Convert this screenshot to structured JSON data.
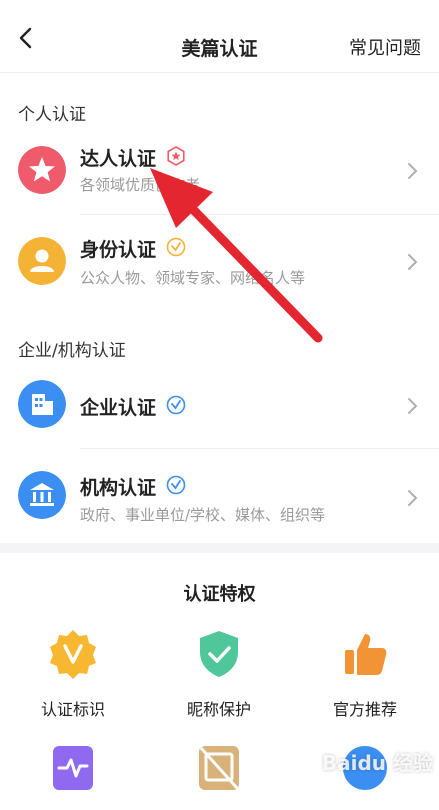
{
  "header": {
    "title": "美篇认证",
    "faq_label": "常见问题"
  },
  "personal": {
    "section_title": "个人认证",
    "items": [
      {
        "name": "达人认证",
        "desc": "各领域优质创作者",
        "icon": "star-icon",
        "color": "#ef5b6b",
        "badge": "red-star-badge-icon"
      },
      {
        "name": "身份认证",
        "desc": "公众人物、领域专家、网络名人等",
        "icon": "person-icon",
        "color": "#f5b335",
        "badge": "yellow-check-badge-icon"
      }
    ]
  },
  "org": {
    "section_title": "企业/机构认证",
    "items": [
      {
        "name": "企业认证",
        "desc": "",
        "icon": "building-icon",
        "color": "#3b8ef2",
        "badge": "blue-check-badge-icon"
      },
      {
        "name": "机构认证",
        "desc": "政府、事业单位/学校、媒体、组织等",
        "icon": "institution-icon",
        "color": "#3b8ef2",
        "badge": "blue-check-badge-icon"
      }
    ]
  },
  "privileges": {
    "title": "认证特权",
    "items": [
      {
        "label": "认证标识",
        "icon": "v-badge-icon"
      },
      {
        "label": "昵称保护",
        "icon": "shield-check-icon"
      },
      {
        "label": "官方推荐",
        "icon": "thumbs-up-icon"
      },
      {
        "label": "",
        "icon": "activity-icon"
      },
      {
        "label": "",
        "icon": "no-ads-icon"
      },
      {
        "label": "",
        "icon": "blue-circle-icon"
      }
    ]
  },
  "watermark": "Baidu 经验",
  "colors": {
    "accent_red": "#e3262f",
    "muted": "#9a9a9a"
  }
}
